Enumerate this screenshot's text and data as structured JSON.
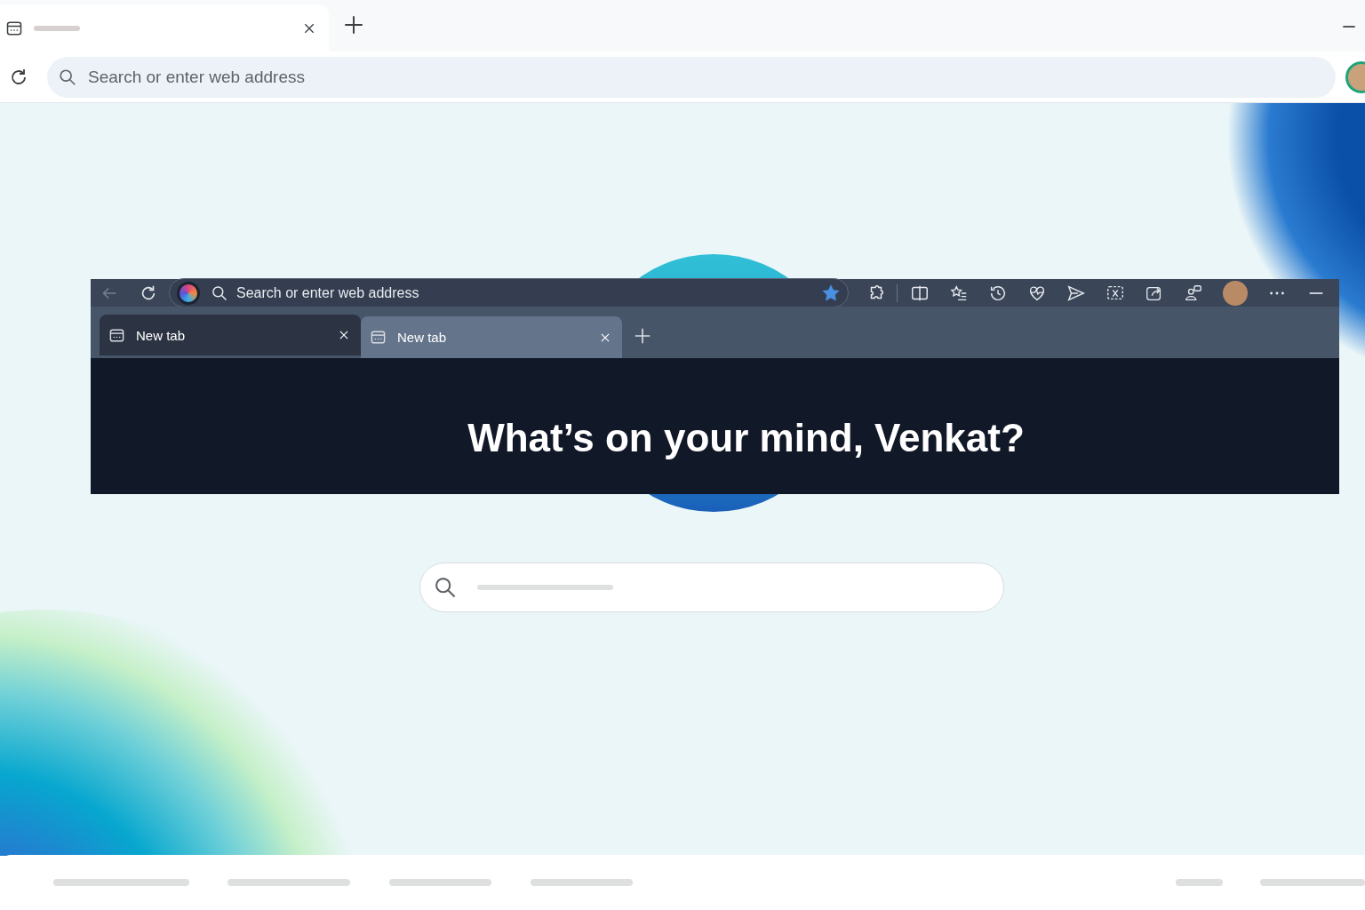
{
  "browser": {
    "address_bar": {
      "placeholder": "Search or enter web address"
    }
  },
  "screenshot": {
    "back_button": {
      "disabled": true
    },
    "address_bar": {
      "placeholder": "Search or enter web address",
      "favorited": true
    },
    "tabs": [
      {
        "label": "New tab",
        "selected": false
      },
      {
        "label": "New tab",
        "selected": true
      }
    ],
    "headline": "What’s on your mind, Venkat?"
  }
}
